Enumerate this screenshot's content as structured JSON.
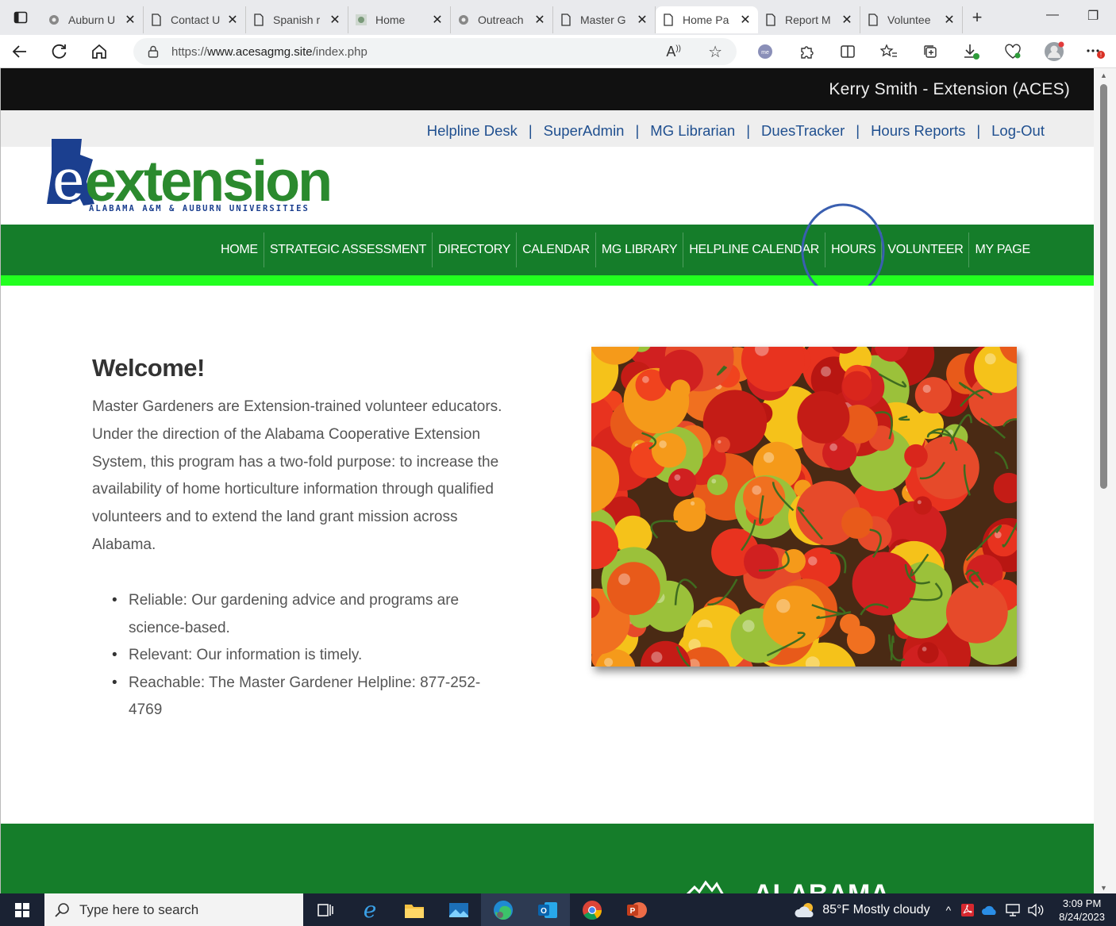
{
  "browser": {
    "tabs": [
      {
        "title": "Auburn U",
        "icon": "gear-favicon"
      },
      {
        "title": "Contact U",
        "icon": "page-icon"
      },
      {
        "title": "Spanish r",
        "icon": "page-icon"
      },
      {
        "title": "Home",
        "icon": "site-favicon"
      },
      {
        "title": "Outreach",
        "icon": "gear-favicon"
      },
      {
        "title": "Master G",
        "icon": "page-icon"
      },
      {
        "title": "Home Pa",
        "icon": "page-icon",
        "active": true
      },
      {
        "title": "Report M",
        "icon": "page-icon"
      },
      {
        "title": "Voluntee",
        "icon": "page-icon"
      }
    ],
    "url_prefix": "https://",
    "url_domain": "www.acesagmg.site",
    "url_path": "/index.php"
  },
  "site": {
    "user_label": "Kerry Smith - Extension (ACES)",
    "top_links": [
      "Helpline Desk",
      "SuperAdmin",
      "MG Librarian",
      "DuesTracker",
      "Hours Reports",
      "Log-Out"
    ],
    "logo_word": "extension",
    "logo_tagline": "ALABAMA A&M & AUBURN UNIVERSITIES",
    "nav": [
      "HOME",
      "STRATEGIC ASSESSMENT",
      "DIRECTORY",
      "CALENDAR",
      "MG LIBRARY",
      "HELPLINE CALENDAR",
      "HOURS",
      "VOLUNTEER",
      "MY PAGE"
    ],
    "highlighted_nav": "HOURS",
    "welcome_title": "Welcome!",
    "welcome_paragraph": "Master Gardeners are Extension-trained volunteer educators. Under the direction of the Alabama Cooperative Extension System, this program has a two-fold purpose: to increase the availability of home horticulture information through qualified volunteers and to extend the land grant mission across Alabama.",
    "bullets": [
      "Reliable: Our gardening advice and programs are science-based.",
      "Relevant: Our information is timely.",
      "Reachable: The Master Gardener Helpline: 877-252-4769"
    ],
    "footer_logo_text": "ALABAMA"
  },
  "taskbar": {
    "search_placeholder": "Type here to search",
    "weather": "85°F  Mostly cloudy",
    "time": "3:09 PM",
    "date": "8/24/2023"
  },
  "colors": {
    "nav_green": "#157d2a",
    "neon_green": "#22ff1f",
    "link_blue": "#1f4f8f",
    "highlight_circle": "#3a5fb0"
  }
}
